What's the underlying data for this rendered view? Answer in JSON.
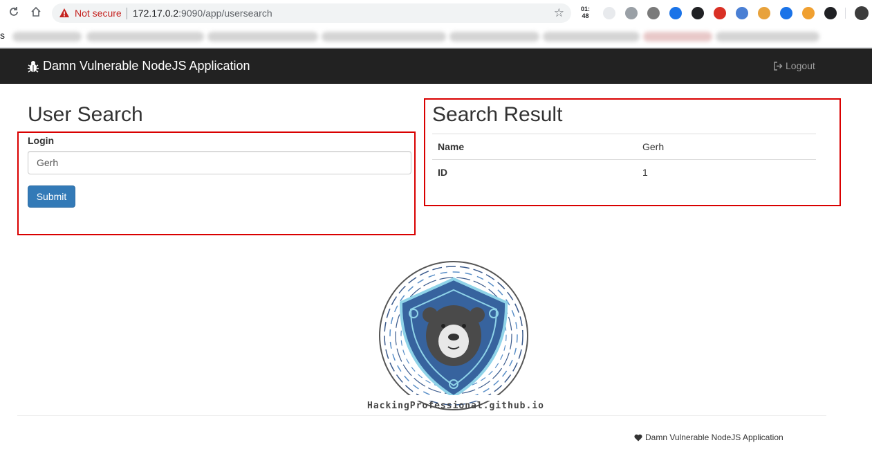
{
  "browser": {
    "security_label": "Not secure",
    "url_host": "172.17.0.2",
    "url_rest": ":9090/app/usersearch",
    "clock_line1": "01:",
    "clock_line2": "48",
    "bookmark_first": "s",
    "ext_colors": [
      "#e8eaed",
      "#9aa0a6",
      "#7a7a7a",
      "#1a73e8",
      "#202124",
      "#d93025",
      "#4a7fd4",
      "#e8a23b",
      "#1a73e8",
      "#f0a030",
      "#202124"
    ],
    "ext_names": [
      "grid-extension-icon",
      "camera-extension-icon",
      "hexagon-extension-icon",
      "di-extension-icon",
      "sa-extension-icon",
      "blocker-extension-icon",
      "globe-extension-icon",
      "fox-extension-icon",
      "eye-extension-icon",
      "cookie-extension-icon",
      "document-extension-icon"
    ]
  },
  "navbar": {
    "brand": "Damn Vulnerable NodeJS Application",
    "logout": "Logout"
  },
  "search": {
    "title": "User Search",
    "login_label": "Login",
    "login_value": "Gerh",
    "submit": "Submit"
  },
  "result": {
    "title": "Search Result",
    "rows": [
      {
        "key": "Name",
        "value": "Gerh"
      },
      {
        "key": "ID",
        "value": "1"
      }
    ]
  },
  "logo": {
    "text": "HackingProfessional.github.io"
  },
  "footer": {
    "text": "Damn Vulnerable NodeJS Application"
  },
  "colors": {
    "annotation": "#d90000",
    "navbar_bg": "#222222",
    "button": "#337ab7"
  }
}
